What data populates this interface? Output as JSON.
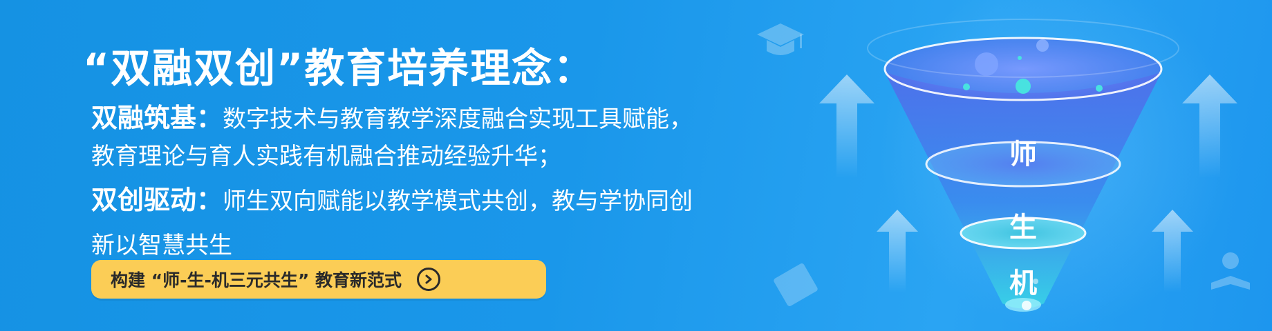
{
  "headline": "“双融双创”教育培养理念：",
  "section1": {
    "label": "双融筑基：",
    "line1": "数字技术与教育教学深度融合实现工具赋能，",
    "line2": "教育理论与育人实践有机融合推动经验升华；"
  },
  "section2": {
    "label": "双创驱动：",
    "line1": "师生双向赋能以教学模式共创，教与学协同创",
    "line2": "新以智慧共生"
  },
  "cta": {
    "label": "构建 “师-生-机三元共生” 教育新范式",
    "icon": "circle-arrow-right-icon"
  },
  "funnel": {
    "levels": [
      "师",
      "生",
      "机"
    ]
  },
  "icons": [
    "graduation-cap-icon",
    "book-icon",
    "student-reading-icon",
    "up-arrow-icon"
  ],
  "colors": {
    "background": "#1a97ea",
    "cta_background": "#fbcd56",
    "text": "#ffffff"
  }
}
